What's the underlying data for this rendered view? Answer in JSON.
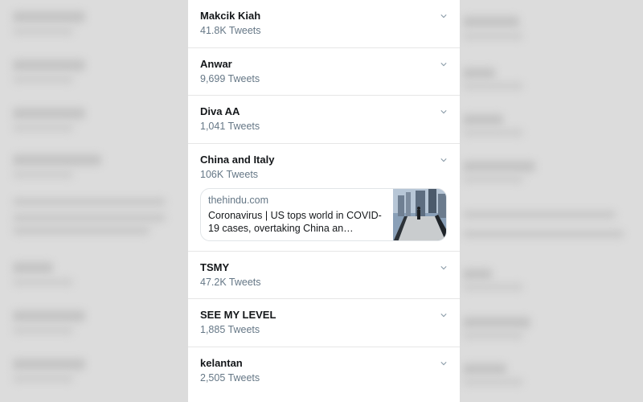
{
  "trends": [
    {
      "name": "Makcik Kiah",
      "count": "41.8K Tweets"
    },
    {
      "name": "Anwar",
      "count": "9,699 Tweets"
    },
    {
      "name": "Diva AA",
      "count": "1,041 Tweets"
    },
    {
      "name": "China and Italy",
      "count": "106K Tweets",
      "card": {
        "domain": "thehindu.com",
        "title": "Coronavirus | US tops world in COVID-19 cases, overtaking China an…",
        "thumbnail_icon": "city-bridge-photo"
      }
    },
    {
      "name": "TSMY",
      "count": "47.2K Tweets"
    },
    {
      "name": "SEE MY LEVEL",
      "count": "1,885 Tweets"
    },
    {
      "name": "kelantan",
      "count": "2,505 Tweets"
    }
  ],
  "icons": {
    "expand": "chevron-down-icon"
  },
  "colors": {
    "name": "#14171a",
    "count": "#657786",
    "divider": "#e6e6e6",
    "background": "#dcdcdc"
  }
}
